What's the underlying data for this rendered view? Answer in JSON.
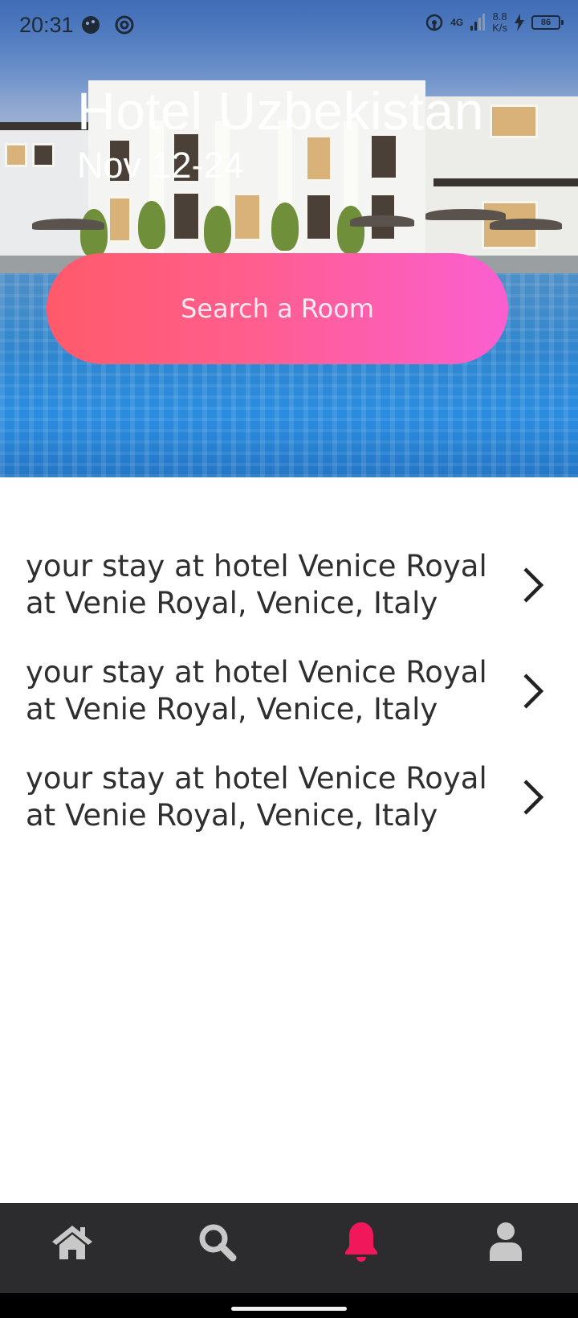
{
  "status_bar": {
    "time": "20:31",
    "network_speed_value": "8.8",
    "network_speed_unit": "K/s",
    "signal_label": "4G",
    "battery_level": "86"
  },
  "hero": {
    "title": "Hotel Uzbekistan",
    "dates": "Nov 12-24",
    "search_button_label": "Search a Room"
  },
  "stays": [
    {
      "title": "your stay at hotel Venice Royal",
      "location": "at Venie Royal, Venice, Italy"
    },
    {
      "title": "your stay at hotel Venice Royal",
      "location": "at Venie Royal, Venice, Italy"
    },
    {
      "title": "your stay at hotel Venice Royal",
      "location": "at Venie Royal, Venice, Italy"
    }
  ],
  "bottom_nav": {
    "items": [
      {
        "icon": "home-icon",
        "active": false
      },
      {
        "icon": "search-icon",
        "active": false
      },
      {
        "icon": "bell-icon",
        "active": true
      },
      {
        "icon": "user-icon",
        "active": false
      }
    ],
    "active_color": "#f0185a",
    "inactive_color": "#c8c8c8"
  },
  "colors": {
    "button_gradient_start": "#ff5a6a",
    "button_gradient_end": "#fb5fd0",
    "nav_background": "#2c2c2e"
  }
}
